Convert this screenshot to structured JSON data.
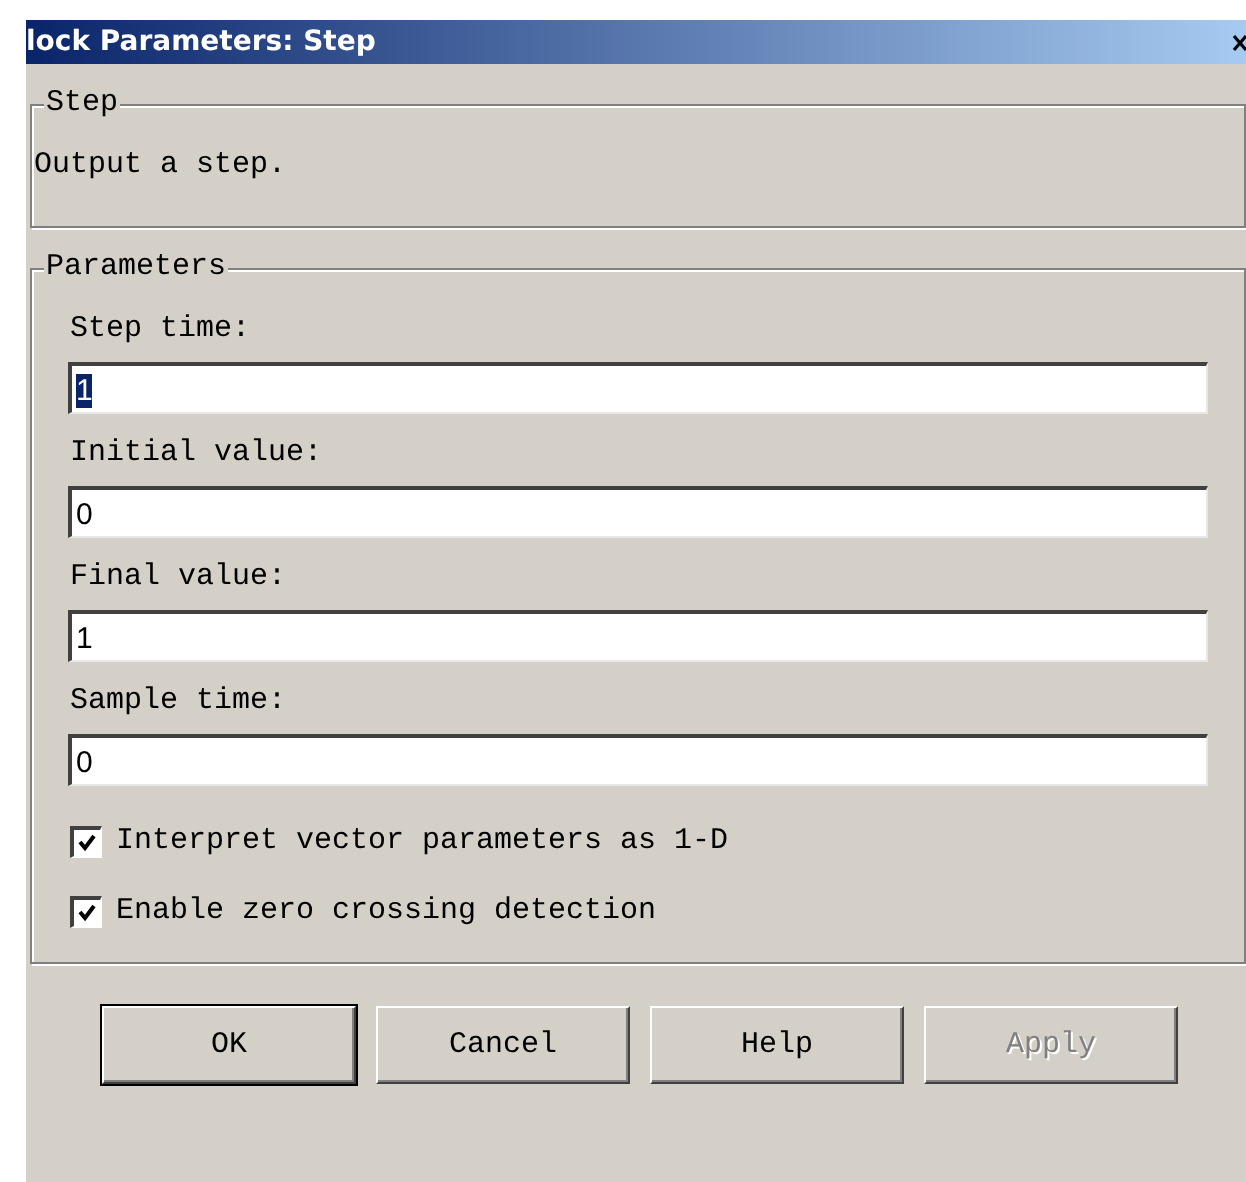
{
  "window": {
    "title": "lock Parameters: Step"
  },
  "description_group": {
    "title": "Step",
    "text": "Output a step."
  },
  "parameters_group": {
    "title": "Parameters",
    "fields": [
      {
        "label": "Step time:",
        "value": "1",
        "selected": true
      },
      {
        "label": "Initial value:",
        "value": "0",
        "selected": false
      },
      {
        "label": "Final value:",
        "value": "1",
        "selected": false
      },
      {
        "label": "Sample time:",
        "value": "0",
        "selected": false
      }
    ],
    "checkboxes": [
      {
        "label": "Interpret vector parameters as 1-D",
        "checked": true
      },
      {
        "label": "Enable zero crossing detection",
        "checked": true
      }
    ]
  },
  "buttons": [
    {
      "label": "OK",
      "default": true,
      "disabled": false
    },
    {
      "label": "Cancel",
      "default": false,
      "disabled": false
    },
    {
      "label": "Help",
      "default": false,
      "disabled": false
    },
    {
      "label": "Apply",
      "default": false,
      "disabled": true
    }
  ]
}
